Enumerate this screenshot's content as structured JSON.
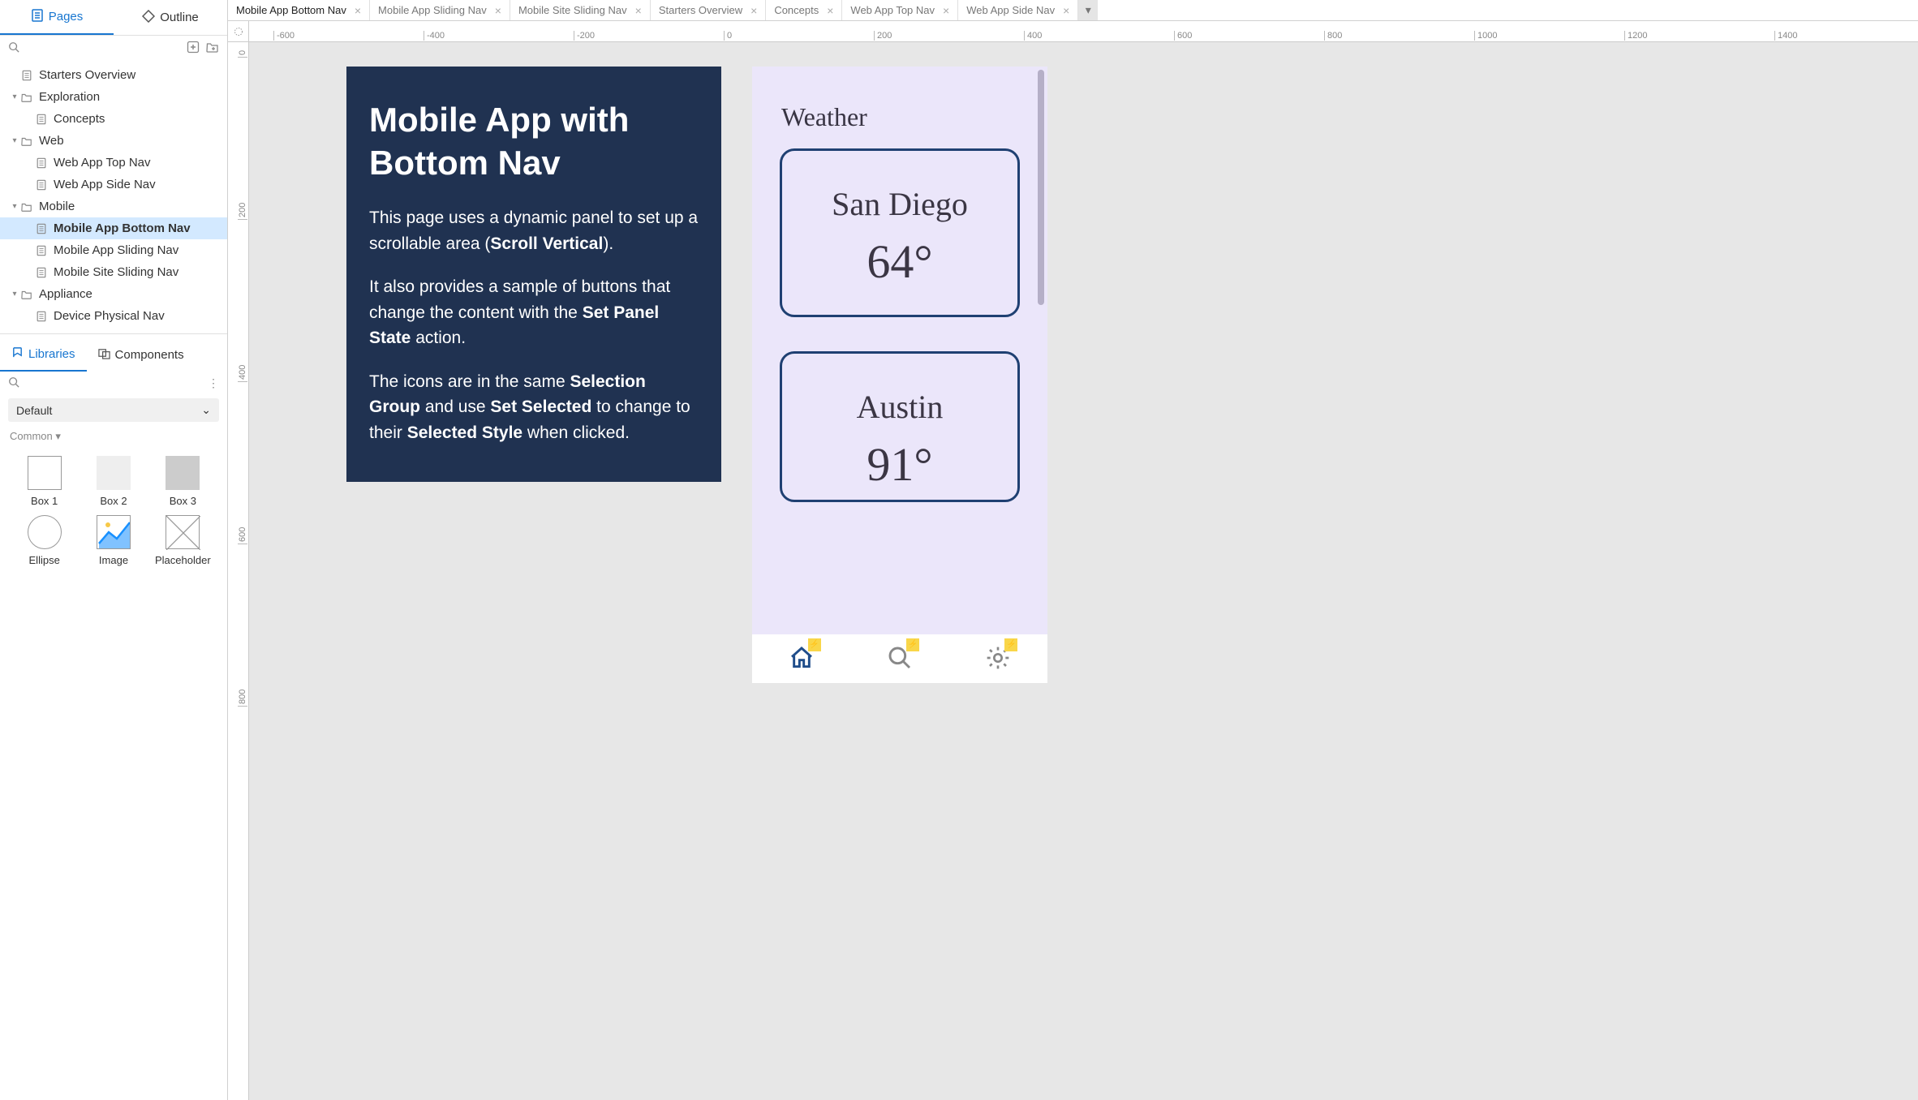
{
  "sidebar": {
    "tabs": {
      "pages": "Pages",
      "outline": "Outline"
    },
    "tree": [
      {
        "label": "Starters Overview",
        "depth": 0,
        "icon": "page",
        "caret": ""
      },
      {
        "label": "Exploration",
        "depth": 0,
        "icon": "folder",
        "caret": "▾"
      },
      {
        "label": "Concepts",
        "depth": 1,
        "icon": "page",
        "caret": ""
      },
      {
        "label": "Web",
        "depth": 0,
        "icon": "folder",
        "caret": "▾"
      },
      {
        "label": "Web App Top Nav",
        "depth": 1,
        "icon": "page",
        "caret": ""
      },
      {
        "label": "Web App Side Nav",
        "depth": 1,
        "icon": "page",
        "caret": ""
      },
      {
        "label": "Mobile",
        "depth": 0,
        "icon": "folder",
        "caret": "▾"
      },
      {
        "label": "Mobile App Bottom Nav",
        "depth": 1,
        "icon": "page",
        "caret": "",
        "selected": true
      },
      {
        "label": "Mobile App Sliding Nav",
        "depth": 1,
        "icon": "page",
        "caret": ""
      },
      {
        "label": "Mobile Site Sliding Nav",
        "depth": 1,
        "icon": "page",
        "caret": ""
      },
      {
        "label": "Appliance",
        "depth": 0,
        "icon": "folder",
        "caret": "▾"
      },
      {
        "label": "Device Physical Nav",
        "depth": 1,
        "icon": "page",
        "caret": ""
      }
    ],
    "libs_tabs": {
      "libraries": "Libraries",
      "components": "Components"
    },
    "libs_select": "Default",
    "libs_category": "Common",
    "widgets": [
      {
        "name": "Box 1"
      },
      {
        "name": "Box 2"
      },
      {
        "name": "Box 3"
      },
      {
        "name": "Ellipse"
      },
      {
        "name": "Image"
      },
      {
        "name": "Placeholder"
      }
    ]
  },
  "tabs": [
    {
      "label": "Mobile App Bottom Nav",
      "active": true
    },
    {
      "label": "Mobile App Sliding Nav"
    },
    {
      "label": "Mobile Site Sliding Nav"
    },
    {
      "label": "Starters Overview"
    },
    {
      "label": "Concepts"
    },
    {
      "label": "Web App Top Nav"
    },
    {
      "label": "Web App Side Nav"
    }
  ],
  "ruler_h": [
    "-600",
    "-400",
    "-200",
    "0",
    "200",
    "400",
    "600",
    "800",
    "1000",
    "1200",
    "1400"
  ],
  "ruler_v": [
    "0",
    "200",
    "400",
    "600",
    "800"
  ],
  "info": {
    "title": "Mobile App with Bottom Nav",
    "p1a": "This page uses a dynamic panel to set up a scrollable area (",
    "p1b": "Scroll Vertical",
    "p1c": ").",
    "p2a": "It also provides a sample of buttons that change the content with the ",
    "p2b": "Set Panel State",
    "p2c": " action.",
    "p3a": "The icons are in the same ",
    "p3b": "Selection Group",
    "p3c": " and use ",
    "p3d": "Set Selected",
    "p3e": "  to change to their ",
    "p3f": "Selected Style",
    "p3g": " when clicked."
  },
  "mockup": {
    "header": "Weather",
    "cards": [
      {
        "city": "San Diego",
        "temp": "64°"
      },
      {
        "city": "Austin",
        "temp": "91°"
      }
    ]
  }
}
